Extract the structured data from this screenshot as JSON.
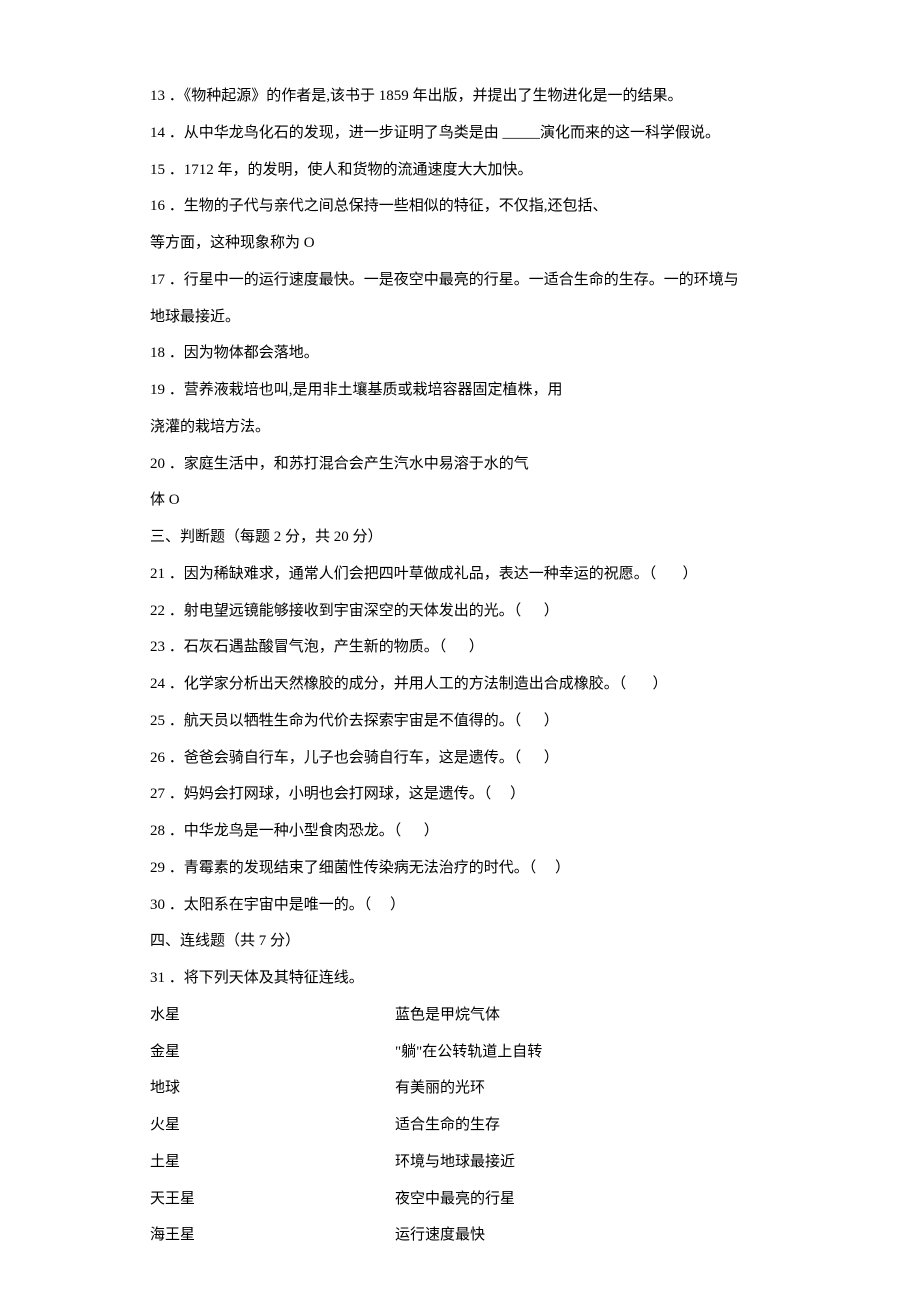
{
  "lines": {
    "l13": "13 ．《物种起源》的作者是,该书于 1859 年出版，并提出了生物进化是一的结果。",
    "l14": "14 ．从中华龙鸟化石的发现，进一步证明了鸟类是由 _____演化而来的这一科学假说。",
    "l15": "15 ．1712 年，的发明，使人和货物的流通速度大大加快。",
    "l16": "16 ．生物的子代与亲代之间总保持一些相似的特征，不仅指,还包括、",
    "l16b": "等方面，这种现象称为 O",
    "l17": "17 ．行星中一的运行速度最快。一是夜空中最亮的行星。一适合生命的生存。一的环境与",
    "l17b": "地球最接近。",
    "l18": "18 ．因为物体都会落地。",
    "l19": "19 ．营养液栽培也叫,是用非土壤基质或栽培容器固定植株，用",
    "l19b": "浇灌的栽培方法。",
    "l20": "20 ．家庭生活中，和苏打混合会产生汽水中易溶于水的气",
    "l20b": "体 O",
    "sec3": "三、判断题（每题 2 分，共 20 分）",
    "l21": "21 ．因为稀缺难求，通常人们会把四叶草做成礼品，表达一种幸运的祝愿。（       ）",
    "l22": "22 ．射电望远镜能够接收到宇宙深空的天体发出的光。（      ）",
    "l23": "23 ．石灰石遇盐酸冒气泡，产生新的物质。（      ）",
    "l24": "24 ．化学家分析出天然橡胶的成分，并用人工的方法制造出合成橡胶。（       ）",
    "l25": "25 ．航天员以牺牲生命为代价去探索宇宙是不值得的。（      ）",
    "l26": "26 ．爸爸会骑自行车，儿子也会骑自行车，这是遗传。（      ）",
    "l27": "27 ．妈妈会打网球，小明也会打网球，这是遗传。（     ）",
    "l28": "28 ．中华龙鸟是一种小型食肉恐龙。（      ）",
    "l29": "29 ．青霉素的发现结束了细菌性传染病无法治疗的时代。（     ）",
    "l30": "30 ．太阳系在宇宙中是唯一的。（     ）",
    "sec4": "四、连线题（共 7 分）",
    "l31": "31 ．将下列天体及其特征连线。"
  },
  "match": [
    {
      "left": "水星",
      "right": "蓝色是甲烷气体"
    },
    {
      "left": "金星",
      "right": "\"躺\"在公转轨道上自转"
    },
    {
      "left": "地球",
      "right": "有美丽的光环"
    },
    {
      "left": "火星",
      "right": "适合生命的生存"
    },
    {
      "left": "土星",
      "right": "环境与地球最接近"
    },
    {
      "left": "天王星",
      "right": "夜空中最亮的行星"
    },
    {
      "left": "海王星",
      "right": "运行速度最快"
    }
  ]
}
